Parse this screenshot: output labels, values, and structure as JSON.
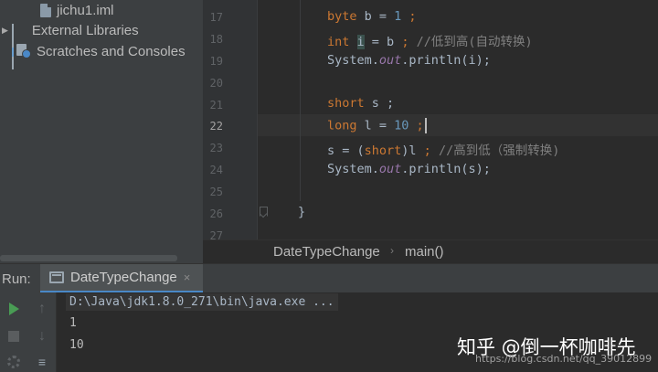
{
  "project_tree": {
    "items": [
      {
        "label": "jichu1.iml",
        "icon": "iml-file-icon"
      },
      {
        "label": "External Libraries",
        "icon": "libraries-icon"
      },
      {
        "label": "Scratches and Consoles",
        "icon": "scratches-icon"
      }
    ]
  },
  "editor": {
    "line_numbers": [
      "17",
      "18",
      "19",
      "20",
      "21",
      "22",
      "23",
      "24",
      "25",
      "26",
      "27"
    ],
    "current_line": "22",
    "lines": {
      "l17": {
        "kw": "byte",
        "mid": " b = ",
        "num": "1",
        "end": " ;"
      },
      "l18": {
        "kw": "int",
        "var": "i",
        "mid": " = b ",
        "semi": ";",
        "comment": " //低到高(自动转换)"
      },
      "l19": {
        "pre": "System.",
        "field": "out",
        "post": ".println(i);"
      },
      "l21": {
        "kw": "short",
        "mid": " s ;"
      },
      "l22": {
        "kw": "long",
        "mid": " l = ",
        "num": "10",
        "end": " ;"
      },
      "l23": {
        "pre": "s = (",
        "kw": "short",
        "mid": ")l ",
        "semi": ";",
        "comment": " //高到低（强制转换)"
      },
      "l24": {
        "pre": "System.",
        "field": "out",
        "post": ".println(s);"
      },
      "l26": {
        "brace": "}"
      }
    }
  },
  "breadcrumb": {
    "class_name": "DateTypeChange",
    "separator": "›",
    "method": "main()"
  },
  "run_panel": {
    "label": "Run:",
    "tab_title": "DateTypeChange",
    "tab_close": "×",
    "command": "D:\\Java\\jdk1.8.0_271\\bin\\java.exe ...",
    "output": [
      "1",
      "10"
    ]
  },
  "watermark": {
    "text": "知乎 @倒一杯咖啡先",
    "url": "https://blog.csdn.net/qq_39012899"
  },
  "colors": {
    "background": "#2b2b2b",
    "panel": "#3c3f41",
    "keyword": "#cc7832",
    "number": "#6897bb",
    "field": "#9876aa",
    "comment": "#808080",
    "run_green": "#499c54",
    "tab_underline": "#4a88c7"
  }
}
